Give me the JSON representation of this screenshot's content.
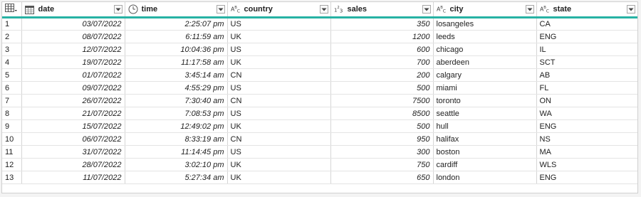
{
  "columns": {
    "date": {
      "label": "date",
      "type_icon": "calendar-icon"
    },
    "time": {
      "label": "time",
      "type_icon": "clock-icon"
    },
    "country": {
      "label": "country",
      "type_icon": "text-type-icon",
      "type_glyph": "Aᴮᴄ"
    },
    "sales": {
      "label": "sales",
      "type_icon": "whole-number-type-icon",
      "type_glyph": "1²3"
    },
    "city": {
      "label": "city",
      "type_icon": "text-type-icon",
      "type_glyph": "Aᴮᴄ"
    },
    "state": {
      "label": "state",
      "type_icon": "text-type-icon",
      "type_glyph": "Aᴮᴄ"
    }
  },
  "colors": {
    "header_underline": "#27b2a4"
  },
  "rows": [
    {
      "n": "1",
      "date": "03/07/2022",
      "time": "2:25:07 pm",
      "country": "US",
      "sales": "350",
      "city": "losangeles",
      "state": "CA"
    },
    {
      "n": "2",
      "date": "08/07/2022",
      "time": "6:11:59 am",
      "country": "UK",
      "sales": "1200",
      "city": "leeds",
      "state": "ENG"
    },
    {
      "n": "3",
      "date": "12/07/2022",
      "time": "10:04:36 pm",
      "country": "US",
      "sales": "600",
      "city": "chicago",
      "state": "IL"
    },
    {
      "n": "4",
      "date": "19/07/2022",
      "time": "11:17:58 am",
      "country": "UK",
      "sales": "700",
      "city": "aberdeen",
      "state": "SCT"
    },
    {
      "n": "5",
      "date": "01/07/2022",
      "time": "3:45:14 am",
      "country": "CN",
      "sales": "200",
      "city": "calgary",
      "state": "AB"
    },
    {
      "n": "6",
      "date": "09/07/2022",
      "time": "4:55:29 pm",
      "country": "US",
      "sales": "500",
      "city": "miami",
      "state": "FL"
    },
    {
      "n": "7",
      "date": "26/07/2022",
      "time": "7:30:40 am",
      "country": "CN",
      "sales": "7500",
      "city": "toronto",
      "state": "ON"
    },
    {
      "n": "8",
      "date": "21/07/2022",
      "time": "7:08:53 pm",
      "country": "US",
      "sales": "8500",
      "city": "seattle",
      "state": "WA"
    },
    {
      "n": "9",
      "date": "15/07/2022",
      "time": "12:49:02 pm",
      "country": "UK",
      "sales": "500",
      "city": "hull",
      "state": "ENG"
    },
    {
      "n": "10",
      "date": "06/07/2022",
      "time": "8:33:19 am",
      "country": "CN",
      "sales": "950",
      "city": "halifax",
      "state": "NS"
    },
    {
      "n": "11",
      "date": "31/07/2022",
      "time": "11:14:45 pm",
      "country": "US",
      "sales": "300",
      "city": "boston",
      "state": "MA"
    },
    {
      "n": "12",
      "date": "28/07/2022",
      "time": "3:02:10 pm",
      "country": "UK",
      "sales": "750",
      "city": "cardiff",
      "state": "WLS"
    },
    {
      "n": "13",
      "date": "11/07/2022",
      "time": "5:27:34 am",
      "country": "UK",
      "sales": "650",
      "city": "london",
      "state": "ENG"
    }
  ]
}
